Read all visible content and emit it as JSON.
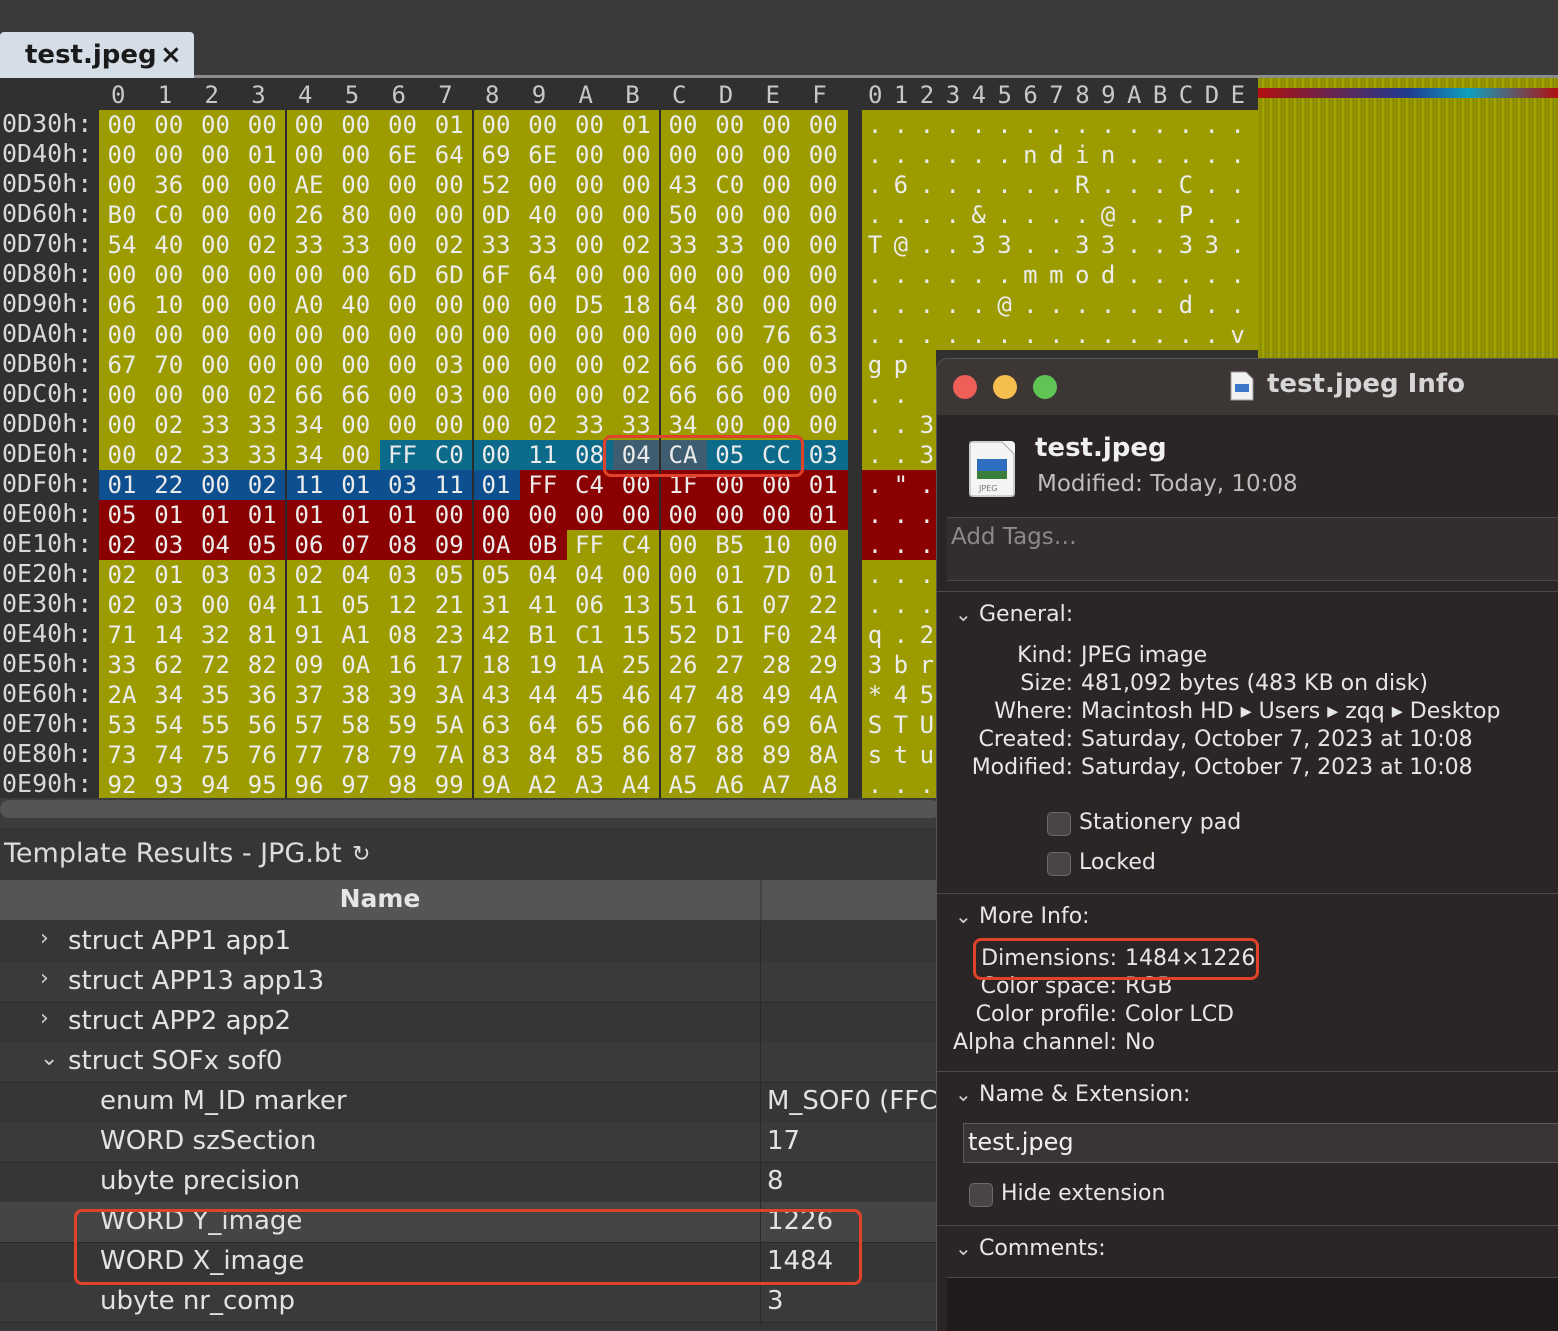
{
  "tab": {
    "title": "test.jpeg",
    "close": "×"
  },
  "hex": {
    "col_headers": [
      "0",
      "1",
      "2",
      "3",
      "4",
      "5",
      "6",
      "7",
      "8",
      "9",
      "A",
      "B",
      "C",
      "D",
      "E",
      "F"
    ],
    "ascii_headers": [
      "0",
      "1",
      "2",
      "3",
      "4",
      "5",
      "6",
      "7",
      "8",
      "9",
      "A",
      "B",
      "C",
      "D",
      "E"
    ],
    "addresses": [
      "0D30h:",
      "0D40h:",
      "0D50h:",
      "0D60h:",
      "0D70h:",
      "0D80h:",
      "0D90h:",
      "0DA0h:",
      "0DB0h:",
      "0DC0h:",
      "0DD0h:",
      "0DE0h:",
      "0DF0h:",
      "0E00h:",
      "0E10h:",
      "0E20h:",
      "0E30h:",
      "0E40h:",
      "0E50h:",
      "0E60h:",
      "0E70h:",
      "0E80h:",
      "0E90h:"
    ],
    "rows": [
      [
        "00",
        "00",
        "00",
        "00",
        "00",
        "00",
        "00",
        "01",
        "00",
        "00",
        "00",
        "01",
        "00",
        "00",
        "00",
        "00"
      ],
      [
        "00",
        "00",
        "00",
        "01",
        "00",
        "00",
        "6E",
        "64",
        "69",
        "6E",
        "00",
        "00",
        "00",
        "00",
        "00",
        "00"
      ],
      [
        "00",
        "36",
        "00",
        "00",
        "AE",
        "00",
        "00",
        "00",
        "52",
        "00",
        "00",
        "00",
        "43",
        "C0",
        "00",
        "00"
      ],
      [
        "B0",
        "C0",
        "00",
        "00",
        "26",
        "80",
        "00",
        "00",
        "0D",
        "40",
        "00",
        "00",
        "50",
        "00",
        "00",
        "00"
      ],
      [
        "54",
        "40",
        "00",
        "02",
        "33",
        "33",
        "00",
        "02",
        "33",
        "33",
        "00",
        "02",
        "33",
        "33",
        "00",
        "00"
      ],
      [
        "00",
        "00",
        "00",
        "00",
        "00",
        "00",
        "6D",
        "6D",
        "6F",
        "64",
        "00",
        "00",
        "00",
        "00",
        "00",
        "00"
      ],
      [
        "06",
        "10",
        "00",
        "00",
        "A0",
        "40",
        "00",
        "00",
        "00",
        "00",
        "D5",
        "18",
        "64",
        "80",
        "00",
        "00"
      ],
      [
        "00",
        "00",
        "00",
        "00",
        "00",
        "00",
        "00",
        "00",
        "00",
        "00",
        "00",
        "00",
        "00",
        "00",
        "76",
        "63"
      ],
      [
        "67",
        "70",
        "00",
        "00",
        "00",
        "00",
        "00",
        "03",
        "00",
        "00",
        "00",
        "02",
        "66",
        "66",
        "00",
        "03"
      ],
      [
        "00",
        "00",
        "00",
        "02",
        "66",
        "66",
        "00",
        "03",
        "00",
        "00",
        "00",
        "02",
        "66",
        "66",
        "00",
        "00"
      ],
      [
        "00",
        "02",
        "33",
        "33",
        "34",
        "00",
        "00",
        "00",
        "00",
        "02",
        "33",
        "33",
        "34",
        "00",
        "00",
        "00"
      ],
      [
        "00",
        "02",
        "33",
        "33",
        "34",
        "00",
        "FF",
        "C0",
        "00",
        "11",
        "08",
        "04",
        "CA",
        "05",
        "CC",
        "03"
      ],
      [
        "01",
        "22",
        "00",
        "02",
        "11",
        "01",
        "03",
        "11",
        "01",
        "FF",
        "C4",
        "00",
        "1F",
        "00",
        "00",
        "01"
      ],
      [
        "05",
        "01",
        "01",
        "01",
        "01",
        "01",
        "01",
        "00",
        "00",
        "00",
        "00",
        "00",
        "00",
        "00",
        "00",
        "01"
      ],
      [
        "02",
        "03",
        "04",
        "05",
        "06",
        "07",
        "08",
        "09",
        "0A",
        "0B",
        "FF",
        "C4",
        "00",
        "B5",
        "10",
        "00"
      ],
      [
        "02",
        "01",
        "03",
        "03",
        "02",
        "04",
        "03",
        "05",
        "05",
        "04",
        "04",
        "00",
        "00",
        "01",
        "7D",
        "01"
      ],
      [
        "02",
        "03",
        "00",
        "04",
        "11",
        "05",
        "12",
        "21",
        "31",
        "41",
        "06",
        "13",
        "51",
        "61",
        "07",
        "22"
      ],
      [
        "71",
        "14",
        "32",
        "81",
        "91",
        "A1",
        "08",
        "23",
        "42",
        "B1",
        "C1",
        "15",
        "52",
        "D1",
        "F0",
        "24"
      ],
      [
        "33",
        "62",
        "72",
        "82",
        "09",
        "0A",
        "16",
        "17",
        "18",
        "19",
        "1A",
        "25",
        "26",
        "27",
        "28",
        "29"
      ],
      [
        "2A",
        "34",
        "35",
        "36",
        "37",
        "38",
        "39",
        "3A",
        "43",
        "44",
        "45",
        "46",
        "47",
        "48",
        "49",
        "4A"
      ],
      [
        "53",
        "54",
        "55",
        "56",
        "57",
        "58",
        "59",
        "5A",
        "63",
        "64",
        "65",
        "66",
        "67",
        "68",
        "69",
        "6A"
      ],
      [
        "73",
        "74",
        "75",
        "76",
        "77",
        "78",
        "79",
        "7A",
        "83",
        "84",
        "85",
        "86",
        "87",
        "88",
        "89",
        "8A"
      ],
      [
        "92",
        "93",
        "94",
        "95",
        "96",
        "97",
        "98",
        "99",
        "9A",
        "A2",
        "A3",
        "A4",
        "A5",
        "A6",
        "A7",
        "A8"
      ]
    ],
    "ascii_rows": [
      [
        ".",
        ".",
        ".",
        ".",
        ".",
        ".",
        ".",
        ".",
        ".",
        ".",
        ".",
        ".",
        ".",
        ".",
        "."
      ],
      [
        ".",
        ".",
        ".",
        ".",
        ".",
        ".",
        "n",
        "d",
        "i",
        "n",
        ".",
        ".",
        ".",
        ".",
        "."
      ],
      [
        ".",
        "6",
        ".",
        ".",
        ".",
        ".",
        ".",
        ".",
        "R",
        ".",
        ".",
        ".",
        "C",
        ".",
        "."
      ],
      [
        ".",
        ".",
        ".",
        ".",
        "&",
        ".",
        ".",
        ".",
        ".",
        "@",
        ".",
        ".",
        "P",
        ".",
        "."
      ],
      [
        "T",
        "@",
        ".",
        ".",
        "3",
        "3",
        ".",
        ".",
        "3",
        "3",
        ".",
        ".",
        "3",
        "3",
        "."
      ],
      [
        ".",
        ".",
        ".",
        ".",
        ".",
        ".",
        "m",
        "m",
        "o",
        "d",
        ".",
        ".",
        ".",
        ".",
        "."
      ],
      [
        ".",
        ".",
        ".",
        ".",
        ".",
        "@",
        ".",
        ".",
        ".",
        ".",
        ".",
        ".",
        "d",
        ".",
        "."
      ],
      [
        ".",
        ".",
        ".",
        ".",
        ".",
        ".",
        ".",
        ".",
        ".",
        ".",
        ".",
        ".",
        ".",
        ".",
        "v"
      ],
      [
        "g",
        "p"
      ],
      [
        ".",
        "."
      ],
      [
        ".",
        ".",
        "3"
      ],
      [
        ".",
        ".",
        "3"
      ],
      [
        ".",
        "\"",
        "."
      ],
      [
        ".",
        ".",
        "."
      ],
      [
        ".",
        ".",
        "."
      ],
      [
        ".",
        ".",
        "."
      ],
      [
        ".",
        ".",
        "."
      ],
      [
        "q",
        ".",
        "2"
      ],
      [
        "3",
        "b",
        "r"
      ],
      [
        "*",
        "4",
        "5"
      ],
      [
        "S",
        "T",
        "U"
      ],
      [
        "s",
        "t",
        "u"
      ],
      [
        ".",
        ".",
        "."
      ]
    ]
  },
  "template": {
    "title": "Template Results - JPG.bt",
    "refresh_icon": "↻",
    "col_name": "Name",
    "rows": [
      {
        "name": "struct APP1 app1",
        "value": "",
        "expander": "›"
      },
      {
        "name": "struct APP13 app13",
        "value": "",
        "expander": "›"
      },
      {
        "name": "struct APP2 app2",
        "value": "",
        "expander": "›"
      },
      {
        "name": "struct SOFx sof0",
        "value": "",
        "expander": "⌄"
      },
      {
        "name": "enum M_ID marker",
        "value": "M_SOF0 (FFC",
        "expander": ""
      },
      {
        "name": "WORD szSection",
        "value": "17",
        "expander": ""
      },
      {
        "name": "ubyte precision",
        "value": "8",
        "expander": ""
      },
      {
        "name": "WORD Y_image",
        "value": "1226",
        "expander": ""
      },
      {
        "name": "WORD X_image",
        "value": "1484",
        "expander": ""
      },
      {
        "name": "ubyte nr_comp",
        "value": "3",
        "expander": ""
      }
    ]
  },
  "info": {
    "title": "test.jpeg Info",
    "file_name": "test.jpeg",
    "icon_label": "JPEG",
    "modified_label": "Modified:",
    "modified_value": "Today, 10:08",
    "tags_placeholder": "Add Tags…",
    "general": {
      "header": "General:",
      "items": [
        {
          "k": "Kind:",
          "v": "JPEG image"
        },
        {
          "k": "Size:",
          "v": "481,092 bytes (483 KB on disk)"
        },
        {
          "k": "Where:",
          "v": "Macintosh HD ▸ Users ▸ zqq ▸ Desktop"
        },
        {
          "k": "Created:",
          "v": "Saturday, October 7, 2023 at 10:08"
        },
        {
          "k": "Modified:",
          "v": "Saturday, October 7, 2023 at 10:08"
        }
      ],
      "stationery": "Stationery pad",
      "locked": "Locked"
    },
    "more": {
      "header": "More Info:",
      "items": [
        {
          "k": "Dimensions:",
          "v": "1484×1226"
        },
        {
          "k": "Color space:",
          "v": "RGB"
        },
        {
          "k": "Color profile:",
          "v": "Color LCD"
        },
        {
          "k": "Alpha channel:",
          "v": "No"
        }
      ]
    },
    "name_ext": {
      "header": "Name & Extension:",
      "value": "test.jpeg",
      "hide_ext": "Hide extension"
    },
    "comments": {
      "header": "Comments:"
    },
    "traffic": {
      "close": "#ed5f57",
      "minimize": "#f5be4f",
      "zoom": "#5fc454"
    }
  }
}
